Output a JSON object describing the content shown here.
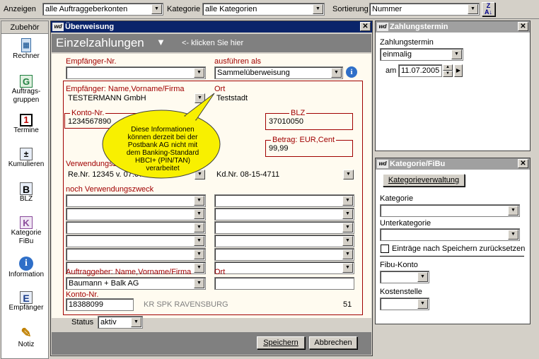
{
  "toolbar": {
    "anzeigen_label": "Anzeigen",
    "anzeigen_value": "alle Auftraggeberkonten",
    "kategorie_label": "Kategorie",
    "kategorie_value": "alle Kategorien",
    "sortierung_label": "Sortierung",
    "sortierung_value": "Nummer",
    "sort_icon": "sort-az-icon"
  },
  "sidebar": {
    "header": "Zubehör",
    "items": [
      {
        "label": "Rechner",
        "icon": "calculator-icon"
      },
      {
        "label": "Auftrags-\ngruppen",
        "icon": "groups-icon"
      },
      {
        "label": "Termine",
        "icon": "calendar-icon"
      },
      {
        "label": "Kumulieren",
        "icon": "cumulate-icon"
      },
      {
        "label": "BLZ",
        "icon": "bank-code-icon"
      },
      {
        "label": "Kategorie\nFiBu",
        "icon": "category-icon"
      },
      {
        "label": "Information",
        "icon": "info-icon"
      },
      {
        "label": "Empfänger",
        "icon": "recipient-icon"
      },
      {
        "label": "Notiz",
        "icon": "note-icon"
      }
    ]
  },
  "main": {
    "title": "Überweisung",
    "section_title": "Einzelzahlungen",
    "click_hint": "<- klicken Sie hier",
    "empfaenger_nr_label": "Empfänger-Nr.",
    "empfaenger_nr_value": "",
    "ausfuehren_label": "ausführen als",
    "ausfuehren_value": "Sammelüberweisung",
    "empfaenger_name_label": "Empfänger: Name,Vorname/Firma",
    "empfaenger_name_value": "TESTERMANN GmbH",
    "ort_label": "Ort",
    "ort_value": "Teststadt",
    "konto_label": "Konto-Nr.",
    "konto_value": "1234567890",
    "blz_label": "BLZ",
    "blz_value": "37010050",
    "betrag_label": "Betrag: EUR,Cent",
    "betrag_value": "99,99",
    "verwendungszweck_label": "Verwendungsz",
    "vz1_value": "Re.Nr. 12345 v. 07.07",
    "vz2_value": "Kd.Nr. 08-15-4711",
    "noch_vz_label": "noch Verwendungszweck",
    "auftraggeber_label": "Auftraggeber: Name,Vorname/Firma",
    "auftraggeber_value": "Baumann + Balk AG",
    "ort2_label": "Ort",
    "ort2_value": "",
    "konto2_label": "Konto-Nr.",
    "konto2_value": "18388099",
    "bank_name": "KR SPK RAVENSBURG",
    "bank_num": "51",
    "status_label": "Status",
    "status_value": "aktiv",
    "save_label": "Speichern",
    "cancel_label": "Abbrechen",
    "tooltip": "Diese Informationen können derzeit bei der Postbank AG nicht mit dem Banking-Standard HBCI+ (PIN/TAN) verarbeitet"
  },
  "zahlungstermin": {
    "title": "Zahlungstermin",
    "label": "Zahlungstermin",
    "value": "einmalig",
    "am_label": "am",
    "date": "11.07.2005"
  },
  "kategorie_fibu": {
    "title": "Kategorie/FiBu",
    "verwaltung_label": "Kategorieverwaltung",
    "kategorie_label": "Kategorie",
    "kategorie_value": "",
    "unterkategorie_label": "Unterkategorie",
    "unterkategorie_value": "",
    "reset_label": "Einträge nach Speichern zurücksetzen",
    "fibu_label": "Fibu-Konto",
    "fibu_value": "",
    "kostenstelle_label": "Kostenstelle",
    "kostenstelle_value": ""
  },
  "colors": {
    "titlebar": "#0a246a",
    "section_header": "#808080",
    "form_bg": "#fffbf0",
    "label_red": "#a00000",
    "tooltip_bg": "#f8f000"
  }
}
